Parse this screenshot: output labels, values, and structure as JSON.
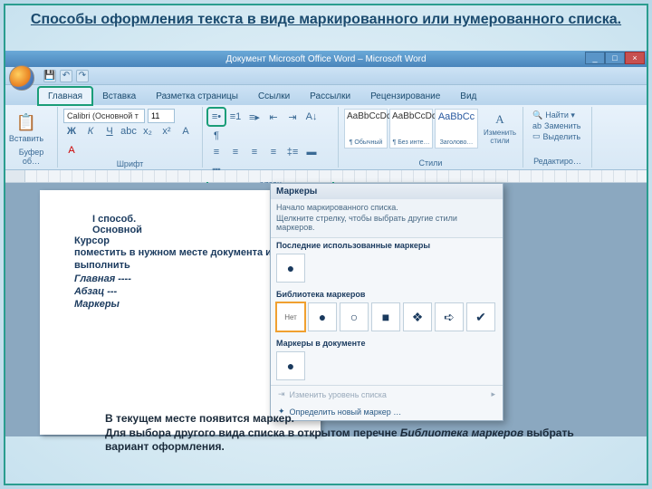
{
  "slide": {
    "title": "Способы оформления текста в виде  маркированного или нумерованного списка."
  },
  "window": {
    "title": "Документ Microsoft Office Word – Microsoft Word"
  },
  "tabs": {
    "home": "Главная",
    "insert": "Вставка",
    "layout": "Разметка страницы",
    "refs": "Ссылки",
    "mail": "Рассылки",
    "review": "Рецензирование",
    "view": "Вид"
  },
  "ribbon": {
    "paste": "Вставить",
    "clipboard_label": "Буфер об…",
    "font_name": "Calibri (Основной т",
    "font_size": "11",
    "font_label": "Шрифт",
    "para_label": "Абзац",
    "styles": {
      "s1_sample": "AaBbCcDc",
      "s1_name": "¶ Обычный",
      "s2_sample": "AaBbCcDc",
      "s2_name": "¶ Без инте…",
      "s3_sample": "AaBbCc",
      "s3_name": "Заголово…",
      "change": "Изменить стили",
      "label": "Стили"
    },
    "editing": {
      "find": "Найти ▾",
      "replace": "Заменить",
      "select": "Выделить",
      "label": "Редактиро…"
    }
  },
  "page": {
    "l1": "I  способ.",
    "l2": "Основной",
    "l3": "Курсор",
    "body1": "поместить в нужном месте документа и выполнить",
    "body2": "Главная ----",
    "body3": "Абзац  ---",
    "body4": "Маркеры"
  },
  "popup": {
    "title": "Маркеры",
    "desc1": "Начало маркированного списка.",
    "desc2": "Щелкните стрелку, чтобы выбрать другие стили маркеров.",
    "sec_recent": "Последние использованные маркеры",
    "sec_lib": "Библиотека маркеров",
    "sec_doc": "Маркеры в документе",
    "none": "Нет",
    "change_level": "Изменить уровень списка",
    "define_new": "Определить новый маркер …"
  },
  "bottom": {
    "l1": "В текущем месте появится маркер.",
    "l2a": "Для выбора другого вида списка  в открытом перечне ",
    "l2b": "Библиотека маркеров",
    "l2c": " выбрать вариант оформления."
  }
}
